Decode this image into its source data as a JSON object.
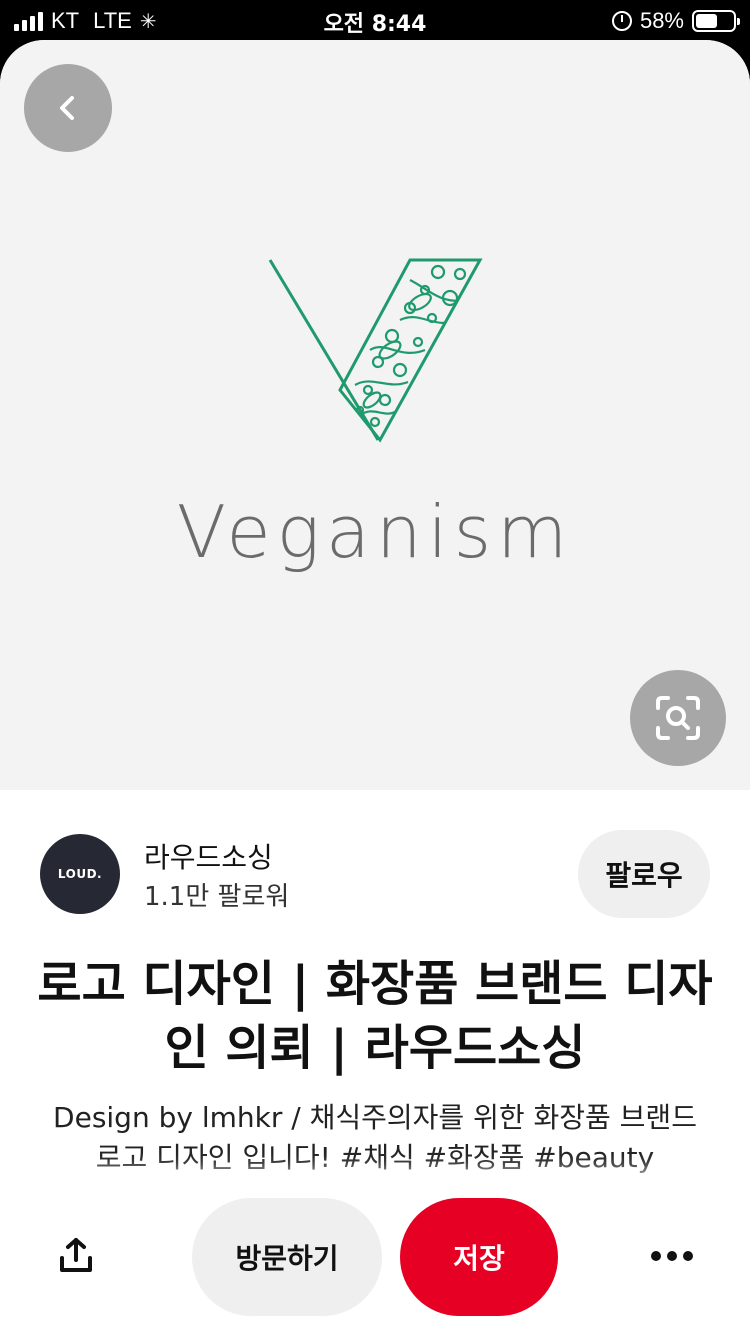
{
  "status_bar": {
    "carrier": "KT",
    "network": "LTE",
    "time": "오전 8:44",
    "battery": "58%",
    "battery_level": 0.58
  },
  "pin": {
    "image_wordmark": "Veganism",
    "brand_color": "#1f9a6e"
  },
  "creator": {
    "avatar_text": "LOUD.",
    "name": "라우드소싱",
    "followers": "1.1만 팔로워",
    "follow_label": "팔로우"
  },
  "title": "로고 디자인 | 화장품 브랜드 디자인 의뢰 | 라우드소싱",
  "description": "Design by lmhkr / 채식주의자를 위한 화장품 브랜드 로고 디자인 입니다! #채식 #화장품 #beauty",
  "actions": {
    "visit_label": "방문하기",
    "save_label": "저장",
    "save_color": "#e60023"
  },
  "icons": {
    "back": "chevron-left-icon",
    "lens": "visual-search-icon",
    "share": "share-icon",
    "more": "more-horizontal-icon"
  }
}
